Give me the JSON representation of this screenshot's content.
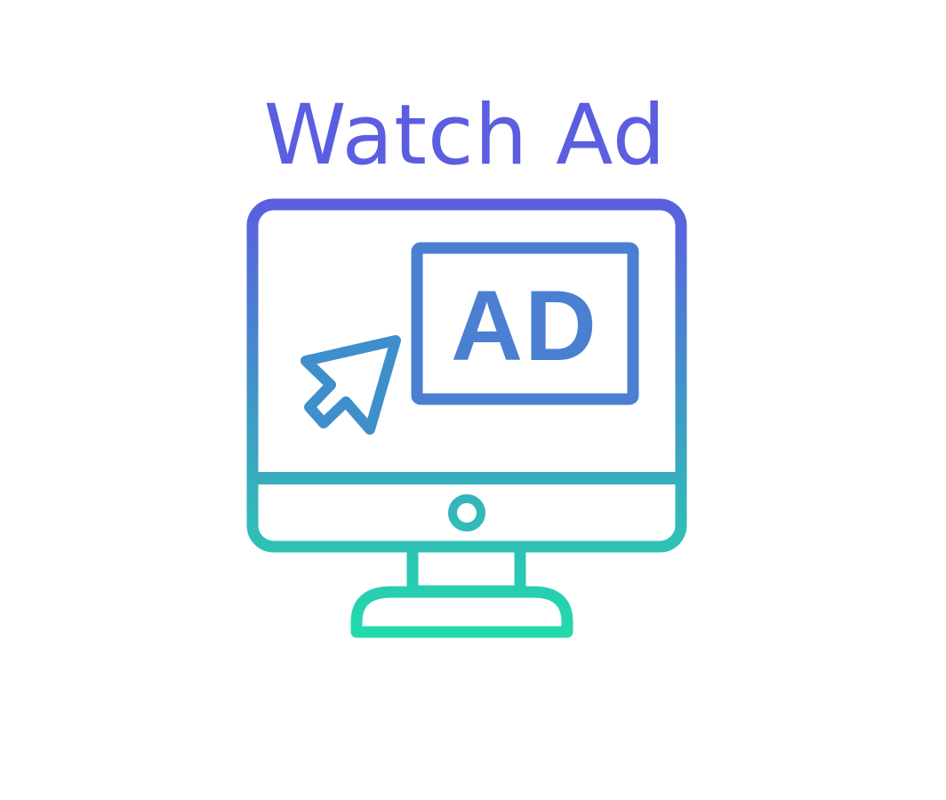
{
  "title": {
    "text": "Watch Ad",
    "color": "#5b5ee0"
  },
  "icon": {
    "name": "monitor-ad-icon",
    "badge_text": "AD",
    "gradient_top": "#5b5ee0",
    "gradient_bottom": "#22dcaa",
    "badge_color": "#4b7fd2",
    "cursor_color": "#3f8fcc"
  }
}
